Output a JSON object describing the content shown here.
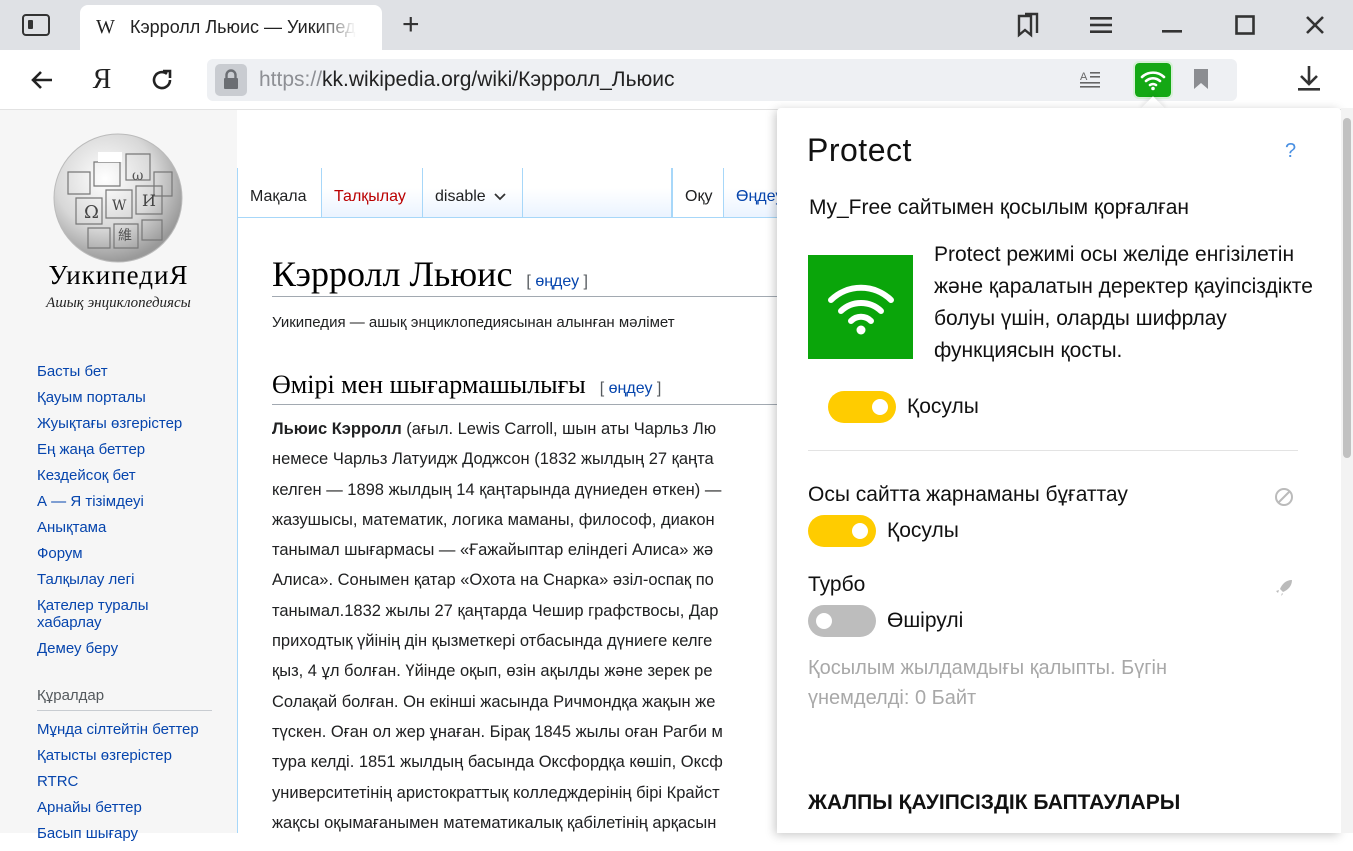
{
  "browser": {
    "tab": {
      "favicon": "W",
      "title": "Кэрролл Льюис — Уикипедия"
    },
    "address": {
      "protocol": "https://",
      "rest": "kk.wikipedia.org/wiki/Кэрролл_Льюис"
    },
    "yandex_button": "Я",
    "icons": [
      "sidebar-icon",
      "plus-icon",
      "bookmarks-icon",
      "menu-icon",
      "minimize-icon",
      "maximize-icon",
      "close-icon",
      "back-icon",
      "reload-icon",
      "lock-icon",
      "reader-mode-icon",
      "wifi-protect-icon",
      "bookmark-icon",
      "download-icon"
    ]
  },
  "wiki": {
    "wordmark": "УикипедиЯ",
    "tagline": "Ашық энциклопедиясы",
    "nav": [
      "Басты бет",
      "Қауым порталы",
      "Жуықтағы өзгерістер",
      "Ең жаңа беттер",
      "Кездейсоқ бет",
      "А — Я тізімдеуі",
      "Анықтама",
      "Форум",
      "Талқылау легі",
      "Қателер туралы хабарлау",
      "Демеу беру"
    ],
    "tools_heading": "Құралдар",
    "tools": [
      "Мұнда сілтейтін беттер",
      "Қатысты өзгерістер",
      "RTRC",
      "Арнайы беттер",
      "Басып шығару"
    ],
    "tabs": {
      "article": "Мақала",
      "talk": "Талқылау",
      "variant": "disable",
      "read": "Оқу",
      "edit": "Өңдеу"
    },
    "title": "Кэрролл Льюис",
    "edit_open": "[ ",
    "edit_word": "өңдеу",
    "edit_close": " ]",
    "from_site": "Уикипедия — ашық энциклопедиясынан алынған мәлімет",
    "section_title": "Өмірі мен шығармашылығы",
    "body_bold": "Льюис Кэрролл",
    "body_first": " (ағыл. Lewis Carroll, шын аты Чарльз Лю",
    "body_lines": [
      "немесе Чарльз Латуидж Доджсон (1832 жылдың 27 қаңта",
      "келген — 1898 жылдың 14 қаңтарында дүниеден өткен) —",
      "жазушысы, математик, логика маманы, философ, диакон",
      "танымал шығармасы — «Ғажайыптар еліндегі Алиса» жә",
      "Алиса». Сонымен қатар «Охота на Снарка» әзіл-оспақ по",
      "танымал.1832 жылы 27 қаңтарда Чешир графствосы, Дар",
      "приходтық үйінің дін қызметкері отбасында дүниеге келге",
      "қыз, 4 ұл болған. Үйінде оқып, өзін ақылды және зерек ре",
      "Солақай болған. Он екінші жасында Ричмондқа жақын же",
      "түскен. Оған ол жер ұнаған. Бірақ 1845 жылы оған Рагби м",
      "тура келді. 1851 жылдың басында Оксфордқа көшіп, Оксф",
      "университетінің аристократтық колледждерінің бірі Крайст",
      "жақсы оқымағанымен математикалық қабілетінің арқасын"
    ]
  },
  "protect": {
    "logo": "Protect",
    "help": "?",
    "connection": "My_Free сайтымен қосылым қорғалған",
    "description": "Protect режимі осы желіде енгізілетін және  қаралатын деректер қауіпсіздікте болуы  үшін, оларды шифрлау функциясын қосты.",
    "wifi_toggle_label": "Қосулы",
    "ads_title": "Осы сайтта жарнаманы бұғаттау",
    "ads_toggle_label": "Қосулы",
    "turbo_title": "Турбо",
    "turbo_toggle_label": "Өшірулі",
    "turbo_note": "Қосылым жылдамдығы қалыпты. Бүгін үнемделді: 0 Байт",
    "security_heading": "ЖАЛПЫ ҚАУІПСІЗДІК БАПТАУЛАРЫ",
    "toggles": {
      "wifi": true,
      "ads": true,
      "turbo": false
    },
    "colors": {
      "accent_green": "#0aa50a",
      "toggle_on": "#ffcc00",
      "toggle_off": "#bdbdbd",
      "link": "#0645ad"
    }
  }
}
